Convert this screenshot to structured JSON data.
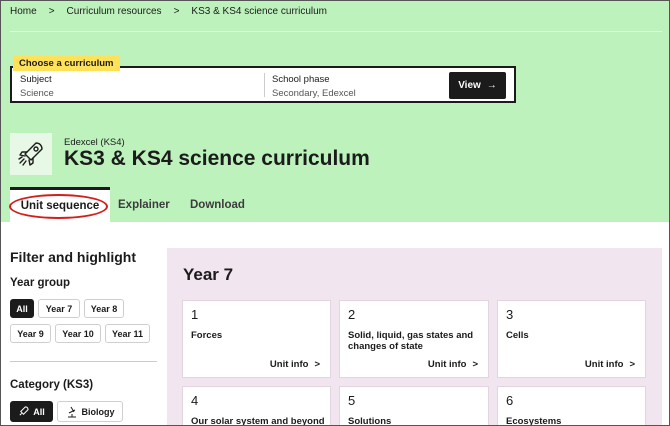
{
  "breadcrumb": {
    "home": "Home",
    "sep": ">",
    "resources": "Curriculum resources",
    "current": "KS3 & KS4 science curriculum"
  },
  "curriculum_picker": {
    "tag": "Choose a curriculum",
    "subject_label": "Subject",
    "subject_value": "Science",
    "phase_label": "School phase",
    "phase_value": "Secondary, Edexcel",
    "view_label": "View",
    "view_arrow": "→"
  },
  "header": {
    "subtitle": "Edexcel (KS4)",
    "title": "KS3 & KS4 science curriculum",
    "logo_icon": "rocket-icon"
  },
  "tabs": [
    {
      "label": "Unit sequence",
      "active": true
    },
    {
      "label": "Explainer",
      "active": false
    },
    {
      "label": "Download",
      "active": false
    }
  ],
  "filters": {
    "title": "Filter and highlight",
    "year_group_label": "Year group",
    "years": [
      "All",
      "Year 7",
      "Year 8",
      "Year 9",
      "Year 10",
      "Year 11"
    ],
    "category_label": "Category (KS3)",
    "categories": [
      "All",
      "Biology"
    ]
  },
  "units": {
    "year_title": "Year 7",
    "info_label": "Unit info",
    "info_arrow": ">",
    "cards": [
      {
        "num": "1",
        "name": "Forces"
      },
      {
        "num": "2",
        "name": "Solid, liquid, gas states and changes of state"
      },
      {
        "num": "3",
        "name": "Cells"
      },
      {
        "num": "4",
        "name": "Our solar system and beyond"
      },
      {
        "num": "5",
        "name": "Solutions"
      },
      {
        "num": "6",
        "name": "Ecosystems"
      }
    ]
  },
  "colors": {
    "hero_bg": "#bef2bd",
    "panel_bg": "#f1e5ef",
    "tag_bg": "#ffe15a",
    "highlight_oval": "#d0201e"
  }
}
